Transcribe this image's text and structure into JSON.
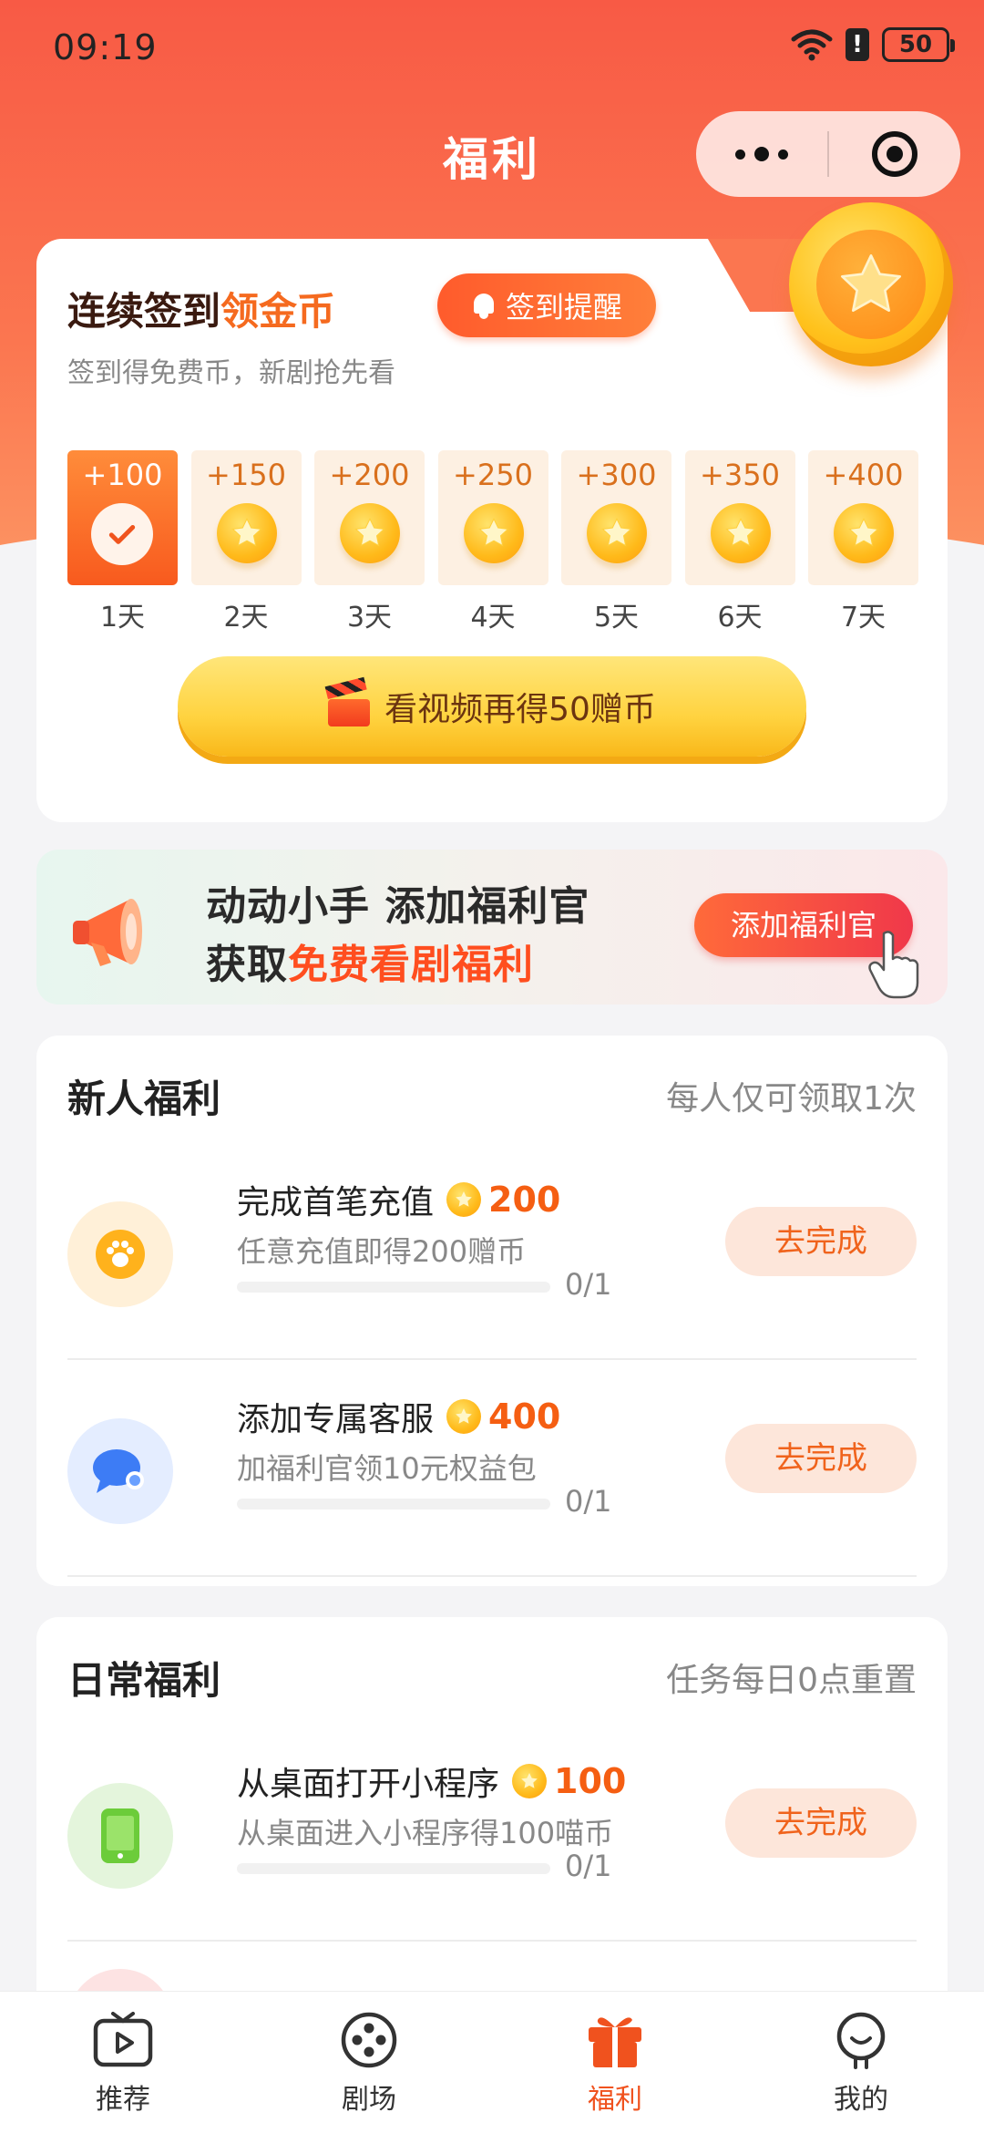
{
  "status_bar": {
    "time": "09:19",
    "alert": "!",
    "battery": "50"
  },
  "header": {
    "title": "福利"
  },
  "signin": {
    "title_prefix": "连续签到",
    "title_highlight": "领金币",
    "remind_label": "签到提醒",
    "subtitle": "签到得免费币，新剧抢先看",
    "days": [
      {
        "amount": "+100",
        "label": "1天",
        "done": true
      },
      {
        "amount": "+150",
        "label": "2天",
        "done": false
      },
      {
        "amount": "+200",
        "label": "3天",
        "done": false
      },
      {
        "amount": "+250",
        "label": "4天",
        "done": false
      },
      {
        "amount": "+300",
        "label": "5天",
        "done": false
      },
      {
        "amount": "+350",
        "label": "6天",
        "done": false
      },
      {
        "amount": "+400",
        "label": "7天",
        "done": false
      }
    ],
    "video_button": "看视频再得50赠币"
  },
  "banner": {
    "line1": "动动小手 添加福利官",
    "line2_prefix": "获取",
    "line2_highlight": "免费看剧福利",
    "button": "添加福利官"
  },
  "newbie": {
    "title": "新人福利",
    "note": "每人仅可领取1次",
    "tasks": [
      {
        "name": "完成首笔充值",
        "reward": "200",
        "desc": "任意充值即得200赠币",
        "progress": "0/1",
        "button": "去完成",
        "icon": "paw-icon"
      },
      {
        "name": "添加专属客服",
        "reward": "400",
        "desc": "加福利官领10元权益包",
        "progress": "0/1",
        "button": "去完成",
        "icon": "chat-icon"
      }
    ]
  },
  "daily": {
    "title": "日常福利",
    "note": "任务每日0点重置",
    "tasks": [
      {
        "name": "从桌面打开小程序",
        "reward": "100",
        "desc": "从桌面进入小程序得100喵币",
        "progress": "0/1",
        "button": "去完成",
        "icon": "phone-icon"
      }
    ]
  },
  "tabbar": {
    "items": [
      {
        "label": "推荐",
        "icon": "tv-icon",
        "active": false
      },
      {
        "label": "剧场",
        "icon": "film-reel-icon",
        "active": false
      },
      {
        "label": "福利",
        "icon": "gift-icon",
        "active": true
      },
      {
        "label": "我的",
        "icon": "profile-icon",
        "active": false
      }
    ]
  },
  "colors": {
    "primary": "#f85a45",
    "accent": "#f56a1f",
    "gold": "#ffc21c"
  }
}
